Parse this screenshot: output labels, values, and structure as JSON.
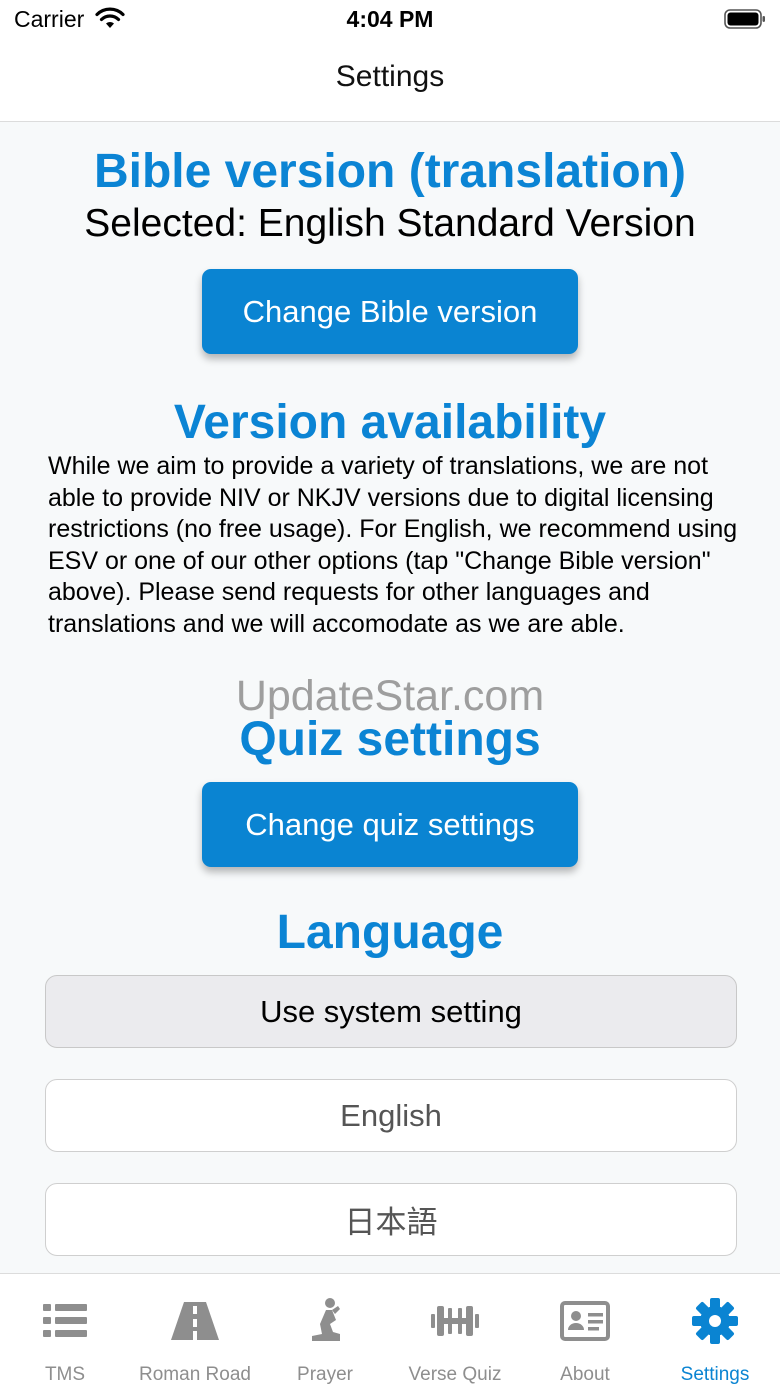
{
  "status_bar": {
    "carrier": "Carrier",
    "time": "4:04 PM"
  },
  "nav": {
    "title": "Settings"
  },
  "bible": {
    "heading": "Bible version (translation)",
    "selected": "Selected: English Standard Version",
    "button": "Change Bible version"
  },
  "availability": {
    "heading": "Version availability",
    "text": "While we aim to provide a variety of translations, we are not able to provide NIV or NKJV versions due to digital licensing restrictions (no free usage). For English, we recommend using ESV or one of our other options (tap \"Change Bible version\" above). Please send requests for other languages and translations and we will accomodate as we are able."
  },
  "watermark": "UpdateStar.com",
  "quiz": {
    "heading": "Quiz settings",
    "button": "Change quiz settings"
  },
  "language": {
    "heading": "Language",
    "options": [
      {
        "label": "Use system setting",
        "selected": true
      },
      {
        "label": "English",
        "selected": false
      },
      {
        "label": "日本語",
        "selected": false
      }
    ]
  },
  "tabs": [
    {
      "label": "TMS",
      "icon": "list-icon",
      "selected": false
    },
    {
      "label": "Roman Road",
      "icon": "road-icon",
      "selected": false
    },
    {
      "label": "Prayer",
      "icon": "praying-person-icon",
      "selected": false
    },
    {
      "label": "Verse Quiz",
      "icon": "dumbbell-icon",
      "selected": false
    },
    {
      "label": "About",
      "icon": "id-card-icon",
      "selected": false
    },
    {
      "label": "Settings",
      "icon": "gear-icon",
      "selected": true
    }
  ],
  "colors": {
    "accent": "#0a84d2",
    "tab_inactive": "#8e8e8e"
  }
}
